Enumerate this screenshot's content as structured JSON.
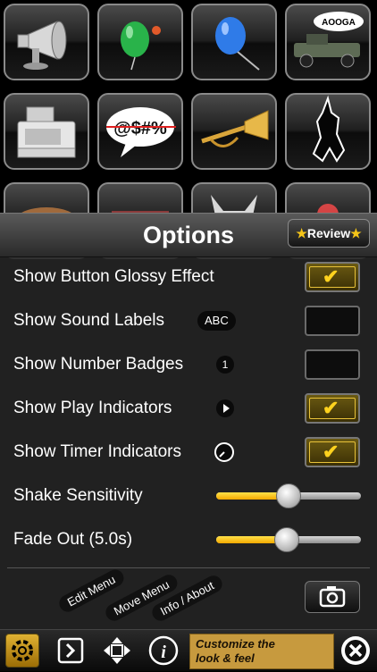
{
  "grid": {
    "row1": [
      {
        "name": "megaphone"
      },
      {
        "name": "green-balloon"
      },
      {
        "name": "blue-balloon"
      },
      {
        "name": "old-car",
        "label": "AOOGA"
      }
    ],
    "row2": [
      {
        "name": "cash-register"
      },
      {
        "name": "swear-bubble",
        "label": "@$#%"
      },
      {
        "name": "trumpet"
      },
      {
        "name": "monkey"
      }
    ]
  },
  "options": {
    "title": "Options",
    "review_label": "Review",
    "rows": [
      {
        "label": "Show Button Glossy Effect",
        "checked": true
      },
      {
        "label": "Show Sound Labels",
        "badge": "ABC",
        "checked": false
      },
      {
        "label": "Show Number Badges",
        "badge": "1",
        "checked": false
      },
      {
        "label": "Show Play Indicators",
        "checked": true
      },
      {
        "label": "Show Timer Indicators",
        "checked": true
      }
    ],
    "sliders": [
      {
        "label": "Shake Sensitivity",
        "value": 0.5
      },
      {
        "label": "Fade Out (5.0s)",
        "value": 0.49
      }
    ],
    "menu_tabs": [
      "Edit Menu",
      "Move Menu",
      "Info / About"
    ]
  },
  "toolbar": {
    "customize_line1": "Customize the",
    "customize_line2": "look & feel",
    "icons": [
      "gear-icon",
      "play-box-icon",
      "move-arrows-icon",
      "info-icon",
      "close-icon"
    ]
  },
  "colors": {
    "accent": "#f5c518",
    "slider_fill": "#f3a800",
    "customize_bg": "#c79a3e"
  }
}
